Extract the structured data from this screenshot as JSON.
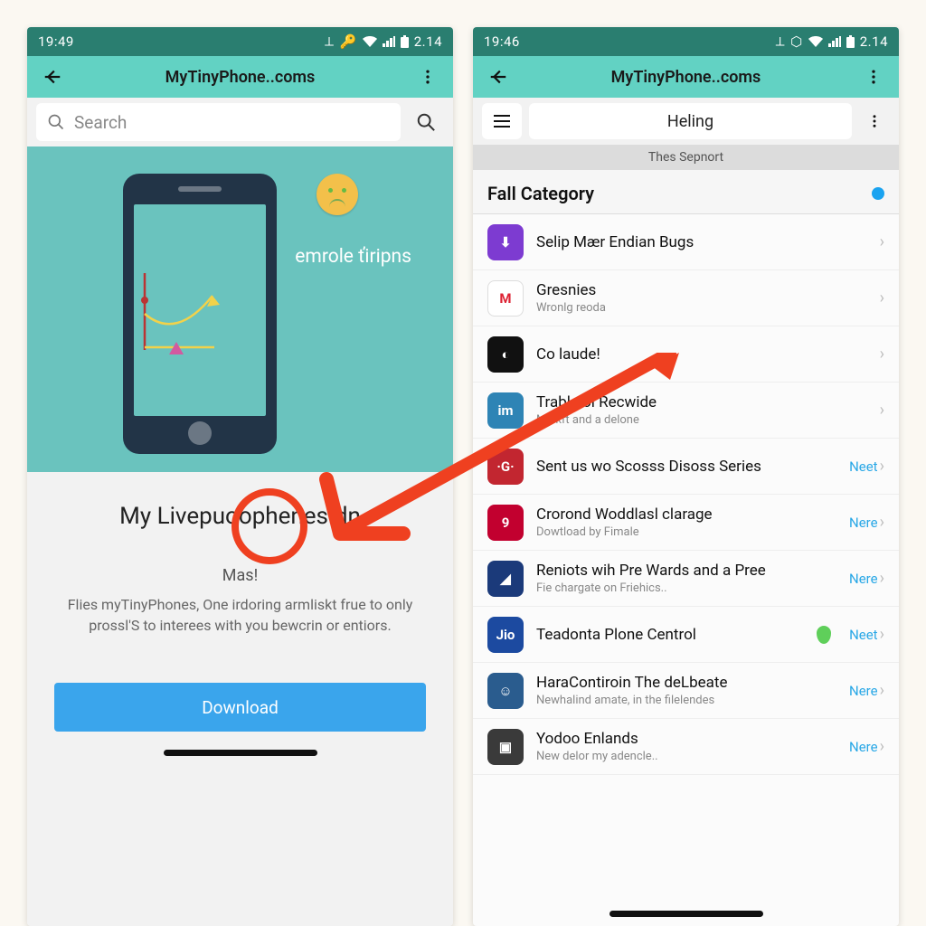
{
  "colors": {
    "statusbar": "#2a7e70",
    "appbar": "#62d2c3",
    "accent_blue": "#3aa5ec",
    "link_blue": "#28a7e6",
    "annotation_red": "#ef4020"
  },
  "left": {
    "status": {
      "time": "19:49",
      "extra": "2.14"
    },
    "appbar_title": "MyTinyPhone..coms",
    "search_placeholder": "Search",
    "hero_label": "emrole ťiripns",
    "app_title": "My Livepuoophenes.dn",
    "subtitle": "Mas!",
    "description": "Flies myTinyPhones, One irdoring armliskt frue to only prossl'S to interees with you bewcrin or entiors.",
    "download_label": "Download"
  },
  "right": {
    "status": {
      "time": "19:46",
      "extra": "2.14"
    },
    "appbar_title": "MyTinyPhone..coms",
    "tab_label": "Heling",
    "thin_bar": "Thes Sepnort",
    "section_header": "Fall Category",
    "items": [
      {
        "title": "Selip Mær Endian Bugs",
        "subtitle": "",
        "action": "",
        "icon_bg": "#7d3bd1",
        "icon_txt": "⬇"
      },
      {
        "title": "Gresnies",
        "subtitle": "Wronlg reoda",
        "action": "",
        "icon_bg": "#ffffff",
        "icon_txt": "M",
        "icon_fg": "#d23"
      },
      {
        "title": "Co laude!",
        "subtitle": "",
        "action": "",
        "icon_bg": "#111",
        "icon_txt": "◐"
      },
      {
        "title": "Trable ol Recwide",
        "subtitle": "Mickft and a delone",
        "action": "",
        "icon_bg": "#2e84b5",
        "icon_txt": "im"
      },
      {
        "title": "Sent us wo Scosss Disoss Series",
        "subtitle": "",
        "action": "Neet",
        "icon_bg": "#c22630",
        "icon_txt": "·G·"
      },
      {
        "title": "Crorond Woddlasl clarage",
        "subtitle": "Dowtload by Fimale",
        "action": "Nere",
        "icon_bg": "#c2002f",
        "icon_txt": "9"
      },
      {
        "title": "Reniots wih Pre Wards and a Pree",
        "subtitle": "Fie chargate on Friehics..",
        "action": "Nere",
        "icon_bg": "#1b3a7a",
        "icon_txt": "◢"
      },
      {
        "title": "Teadonta Plone Centrol",
        "subtitle": "",
        "action": "Neet",
        "icon_bg": "#1c4aa0",
        "icon_txt": "Jio",
        "green_badge": true
      },
      {
        "title": "HaraContiroin The deLbeate",
        "subtitle": "Newhalind amate, in the filelendes",
        "action": "Nere",
        "icon_bg": "#2a5c8e",
        "icon_txt": "☺"
      },
      {
        "title": "Yodoo Enlands",
        "subtitle": "New delor my adencle..",
        "action": "Nere",
        "icon_bg": "#3a3a3a",
        "icon_txt": "▣"
      }
    ]
  }
}
